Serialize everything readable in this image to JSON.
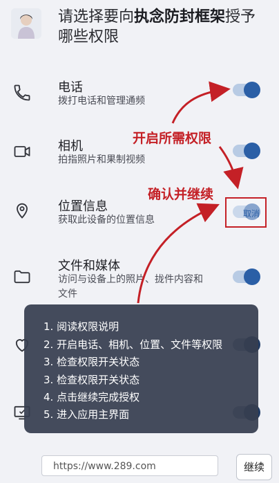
{
  "header": {
    "title_prefix": "请选择要向",
    "app_name": "执念防封框架",
    "title_suffix": "授予哪些权限"
  },
  "permissions": [
    {
      "name": "电话",
      "desc": "拨打电话和管理通频",
      "icon": "phone-icon",
      "state": "on"
    },
    {
      "name": "相机",
      "desc": "拍指照片和果制视频",
      "icon": "camera-icon",
      "state": "on"
    },
    {
      "name": "位置信息",
      "desc": "获取此设备的位置信息",
      "icon": "location-pin-icon",
      "state": "on",
      "toggle_label": "取消"
    },
    {
      "name": "文件和媒体",
      "desc": "访问与设备上的照片、拢件内容和文件",
      "icon": "folder-icon",
      "state": "on"
    },
    {
      "name": "",
      "desc": "",
      "icon": "heart-icon",
      "state": "on"
    },
    {
      "name": "",
      "desc": "",
      "icon": "screen-share-icon",
      "state": "on"
    }
  ],
  "annotations": {
    "enable": "开启所需权限",
    "confirm": "确认并继续"
  },
  "steps": [
    "1. 阅读权限说明",
    "2. 开启电话、相机、位置、文件等权限",
    "3. 检查权限开关状态",
    "3. 检查权限开关状态",
    "4. 点击继续完成授权",
    "5. 进入应用主界面"
  ],
  "bottom": {
    "url": "https://www.289.com",
    "continue_label": "继续"
  },
  "colors": {
    "accent": "#2b5fa6",
    "annotation_red": "#c42026",
    "overlay": "#373e50"
  }
}
